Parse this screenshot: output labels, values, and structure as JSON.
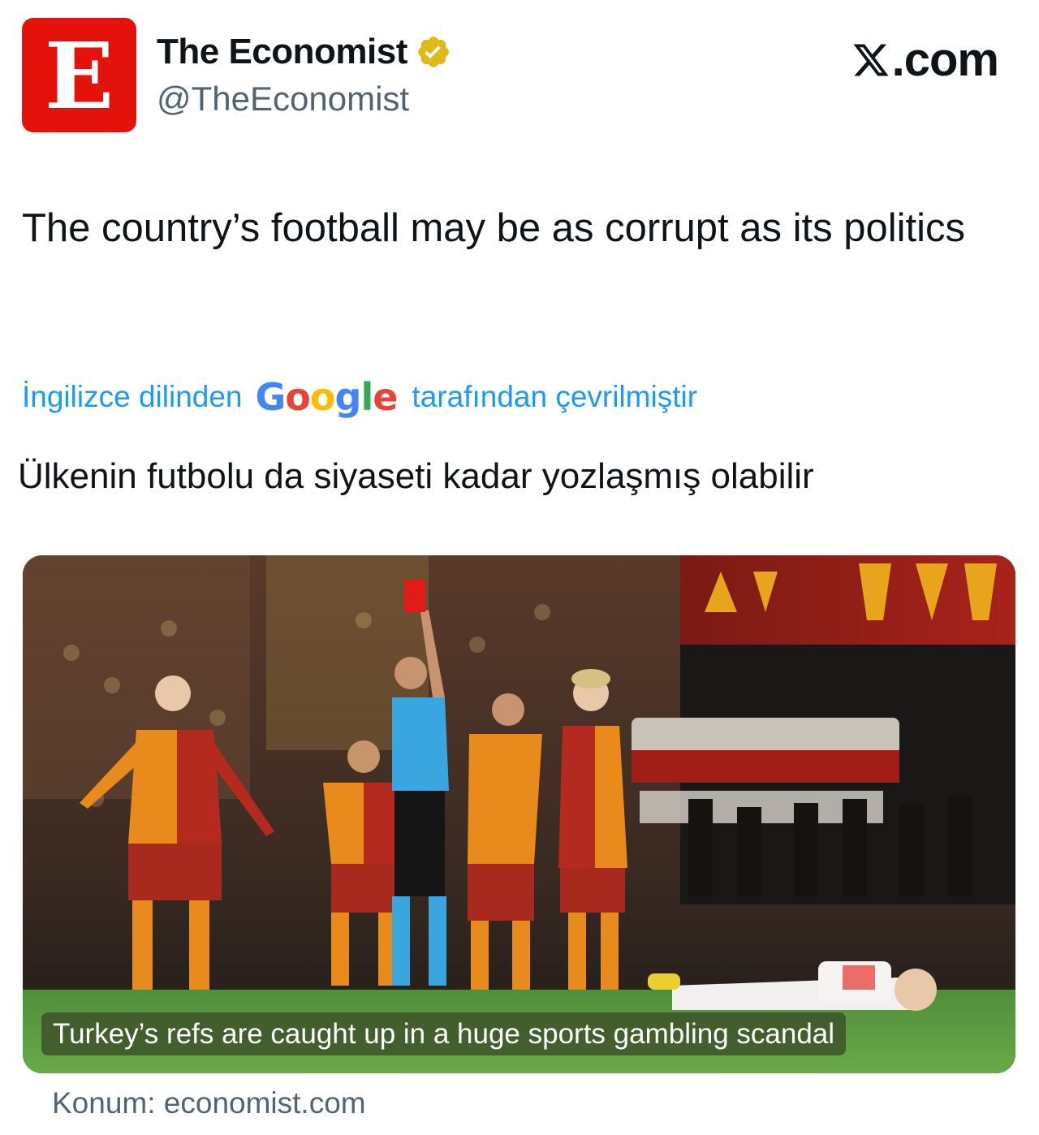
{
  "author": {
    "logo_letter": "E",
    "name": "The Economist",
    "handle": "@TheEconomist",
    "verified_icon": "verified-badge-gold"
  },
  "site": {
    "label": ".com",
    "logo_icon": "x-logo"
  },
  "tweet": {
    "text": "The country’s football may be as corrupt as its politics"
  },
  "translation": {
    "prefix": "İngilizce dilinden",
    "provider_letters": [
      "G",
      "o",
      "o",
      "g",
      "l",
      "e"
    ],
    "suffix": "tarafından çevrilmiştir",
    "translated_text": "Ülkenin futbolu da siyaseti kadar yozlaşmış olabilir"
  },
  "card": {
    "caption": "Turkey’s refs are caught up in a huge sports gambling scandal",
    "source": "Konum: economist.com"
  },
  "colors": {
    "logo_red": "#e3120b",
    "link_blue": "#1d9bf0",
    "secondary_gray": "#536471",
    "verified_gold": "#e2b719"
  }
}
